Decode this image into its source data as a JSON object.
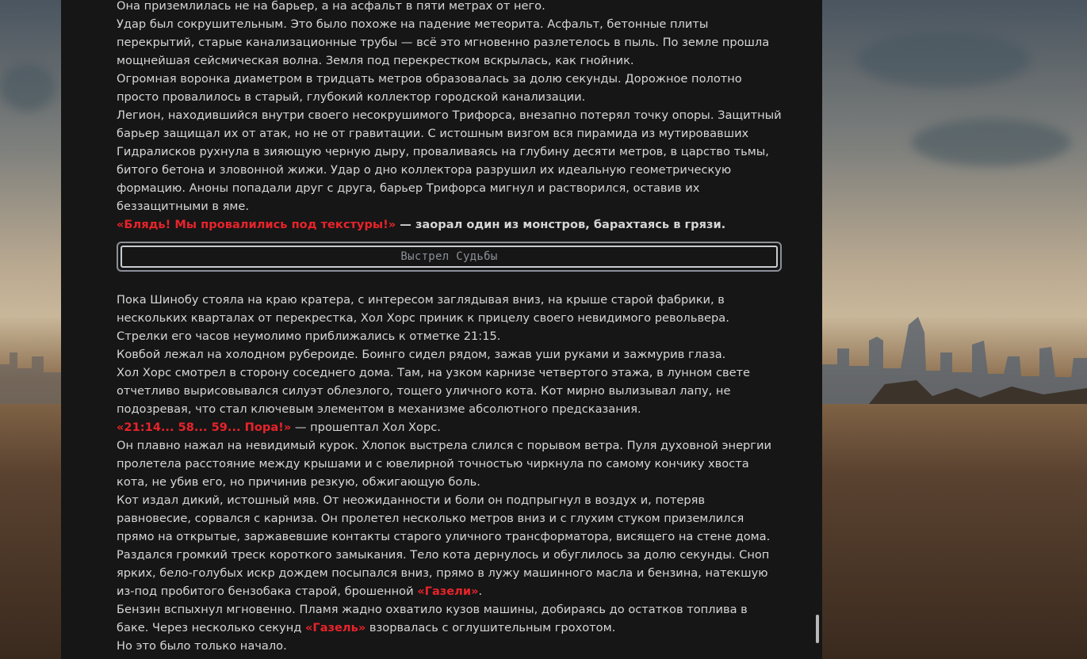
{
  "story": {
    "block1": [
      {
        "parts": [
          {
            "text": "Она приземлилась не на барьер, а на асфальт в пяти метрах от него."
          }
        ]
      },
      {
        "parts": [
          {
            "text": "Удар был сокрушительным. Это было похоже на падение метеорита. Асфальт, бетонные плиты перекрытий, старые канализационные трубы — всё это мгновенно разлетелось в пыль. По земле прошла мощнейшая сейсмическая волна. Земля под перекрестком вскрылась, как гнойник."
          }
        ]
      },
      {
        "parts": [
          {
            "text": "Огромная воронка диаметром в тридцать метров образовалась за долю секунды. Дорожное полотно просто провалилось в старый, глубокий коллектор городской канализации."
          }
        ]
      },
      {
        "parts": [
          {
            "text": "Легион, находившийся внутри своего несокрушимого Трифорса, внезапно потерял точку опоры. Защитный барьер защищал их от атак, но не от гравитации. С истошным визгом вся пирамида из мутировавших Гидралисков рухнула в зияющую черную дыру, проваливаясь на глубину десяти метров, в царство тьмы, битого бетона и зловонной жижи. Удар о дно коллектора разрушил их идеальную геометрическую формацию. Аноны попадали друг с друга, барьер Трифорса мигнул и растворился, оставив их беззащитными в яме."
          }
        ]
      },
      {
        "parts": [
          {
            "text": "«Блядь! Мы провалились под текстуры!»",
            "red": true
          },
          {
            "text": " — заорал один из монстров, барахтаясь в грязи.",
            "bold": true
          }
        ]
      }
    ],
    "divider_label": "Выстрел Судьбы",
    "block2": [
      {
        "parts": [
          {
            "text": "Пока Шинобу стояла на краю кратера, с интересом заглядывая вниз, на крыше старой фабрики, в нескольких кварталах от перекрестка, Хол Хорс приник к прицелу своего невидимого револьвера."
          }
        ]
      },
      {
        "parts": [
          {
            "text": "Стрелки его часов неумолимо приближались к отметке 21:15."
          }
        ]
      },
      {
        "parts": [
          {
            "text": "Ковбой лежал на холодном рубероиде. Боинго сидел рядом, зажав уши руками и зажмурив глаза."
          }
        ]
      },
      {
        "parts": [
          {
            "text": "Хол Хорс смотрел в сторону соседнего дома. Там, на узком карнизе четвертого этажа, в лунном свете отчетливо вырисовывался силуэт облезлого, тощего уличного кота. Кот мирно вылизывал лапу, не подозревая, что стал ключевым элементом в механизме абсолютного предсказания."
          }
        ]
      },
      {
        "parts": [
          {
            "text": "«21:14... 58... 59... Пора!»",
            "red": true
          },
          {
            "text": " — прошептал Хол Хорс."
          }
        ]
      },
      {
        "parts": [
          {
            "text": "Он плавно нажал на невидимый курок. Хлопок выстрела слился с порывом ветра. Пуля духовной энергии пролетела расстояние между крышами и с ювелирной точностью чиркнула по самому кончику хвоста кота, не убив его, но причинив резкую, обжигающую боль."
          }
        ]
      },
      {
        "parts": [
          {
            "text": "Кот издал дикий, истошный мяв. От неожиданности и боли он подпрыгнул в воздух и, потеряв равновесие, сорвался с карниза. Он пролетел несколько метров вниз и с глухим стуком приземлился прямо на открытые, заржавевшие контакты старого уличного трансформатора, висящего на стене дома."
          }
        ]
      },
      {
        "parts": [
          {
            "text": "Раздался громкий треск короткого замыкания. Тело кота дернулось и обуглилось за долю секунды. Сноп ярких, бело-голубых искр дождем посыпался вниз, прямо в лужу машинного масла и бензина, натекшую из-под пробитого бензобака старой, брошенной "
          },
          {
            "text": "«Газели»",
            "red": true
          },
          {
            "text": "."
          }
        ]
      },
      {
        "parts": [
          {
            "text": "Бензин вспыхнул мгновенно. Пламя жадно охватило кузов машины, добираясь до остатков топлива в баке. Через несколько секунд "
          },
          {
            "text": "«Газель»",
            "red": true
          },
          {
            "text": " взорвалась с оглушительным грохотом."
          }
        ]
      },
      {
        "parts": [
          {
            "text": "Но это было только начало."
          }
        ]
      }
    ]
  },
  "colors": {
    "panel_bg": "#161616",
    "text": "#d6d6d6",
    "accent_red": "#e8232a",
    "divider_border": "#c8ccd0"
  }
}
